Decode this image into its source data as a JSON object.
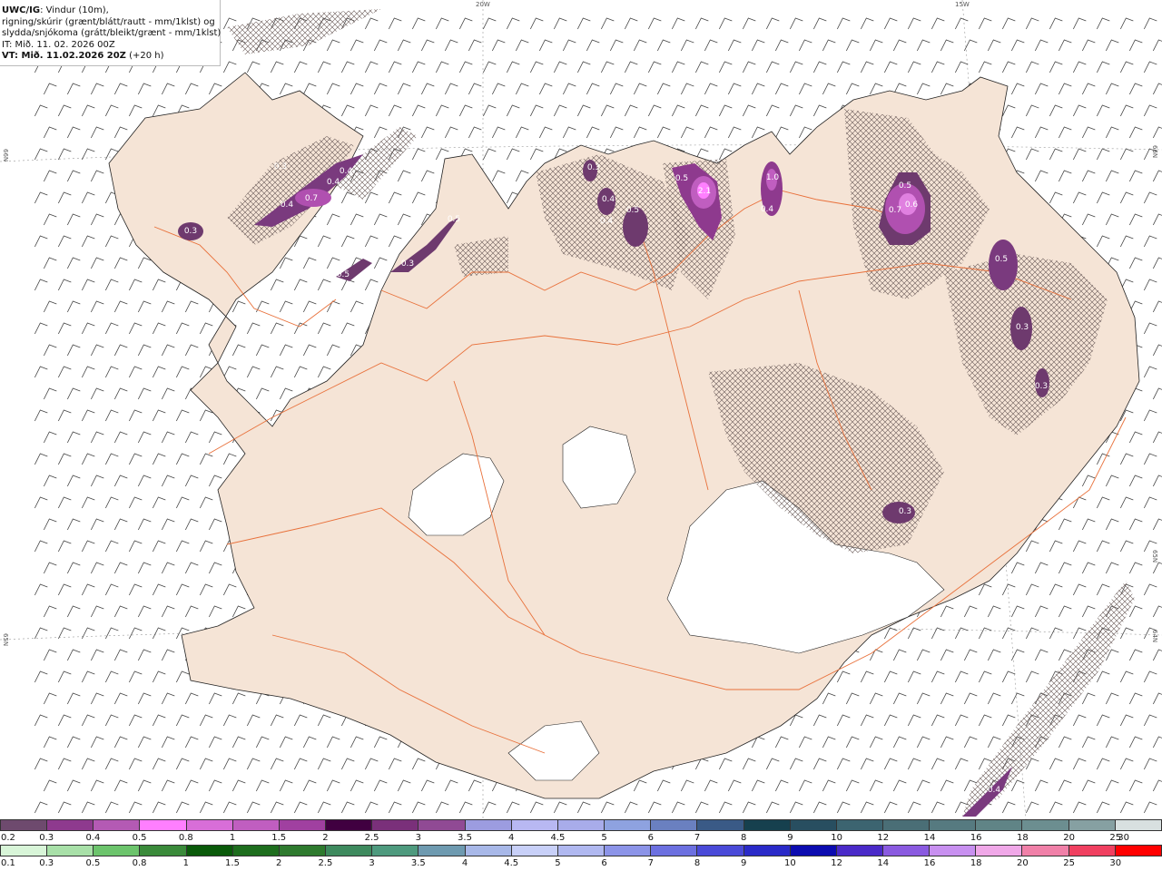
{
  "info": {
    "title_bold": "UWC/IG",
    "title_rest": ": Vindur (10m),",
    "line2": "rigning/skúrir (grænt/blátt/rautt - mm/1klst) og",
    "line3": "slydda/snjókoma (grátt/bleikt/grænt - mm/1klst)",
    "line4": "IT: Mið. 11. 02. 2026 00Z",
    "line5_bold": "VT: Mið. 11.02.2026 20Z",
    "line5_rest": " (+20 h)"
  },
  "axes": {
    "lon_top": [
      "20W",
      "15W"
    ],
    "lat_left": [
      "66N",
      "65N"
    ],
    "lat_right": [
      "66N",
      "65N",
      "64N"
    ]
  },
  "precip_labels": [
    "0.3",
    "0.3",
    "0.4",
    "0.7",
    "0.4",
    "0.4",
    "0.2",
    "0.5",
    "0.3",
    "0.5",
    "0.3",
    "0.4",
    "0.4",
    "0.5",
    "0.5",
    "2.1",
    "0.4",
    "1.0",
    "0.5",
    "0.7",
    "0.6",
    "0.5",
    "0.3",
    "0.3",
    "0.3",
    "0.4"
  ],
  "snow_scale": {
    "ticks": [
      "0.2",
      "0.3",
      "0.4",
      "0.5",
      "0.8",
      "1",
      "1.5",
      "2",
      "2.5",
      "3",
      "3.5",
      "4",
      "4.5",
      "5",
      "6",
      "7",
      "8",
      "9",
      "10",
      "12",
      "14",
      "16",
      "18",
      "20",
      "25",
      "30"
    ],
    "colors": [
      "#6e4a6e",
      "#8e3a8e",
      "#b45ab4",
      "#ff7fff",
      "#d86ed8",
      "#c05ec0",
      "#a040a0",
      "#400040",
      "#7a307a",
      "#904a94",
      "#9c9ce0",
      "#b8b8f2",
      "#a8acea",
      "#8ea2e0",
      "#6a80c0",
      "#3a5a86",
      "#16404e",
      "#284e60",
      "#3c6470",
      "#4a6e76",
      "#567a80",
      "#608486",
      "#6c8e90",
      "#86a0a2",
      "#d8e0e0"
    ]
  },
  "rain_scale": {
    "ticks": [
      "0.1",
      "0.3",
      "0.5",
      "0.8",
      "1",
      "1.5",
      "2",
      "2.5",
      "3",
      "3.5",
      "4",
      "4.5",
      "5",
      "6",
      "7",
      "8",
      "9",
      "10",
      "12",
      "14",
      "16",
      "18",
      "20",
      "25",
      "30"
    ],
    "colors": [
      "#d8f5d8",
      "#a8e0a8",
      "#6cc46c",
      "#3a8a3a",
      "#0a5a0a",
      "#1e6e1e",
      "#2e7a2e",
      "#3e8a5e",
      "#4e9a7e",
      "#6e9ab0",
      "#a8b8e8",
      "#c8d0f8",
      "#b0b8f0",
      "#8c94e8",
      "#6c70e0",
      "#4a4ad8",
      "#2a2ac8",
      "#0c0cb0",
      "#4a2ac8",
      "#8a5ae0",
      "#c890f0",
      "#f0a8e8",
      "#f080a8",
      "#f04060",
      "#ff0000"
    ]
  }
}
